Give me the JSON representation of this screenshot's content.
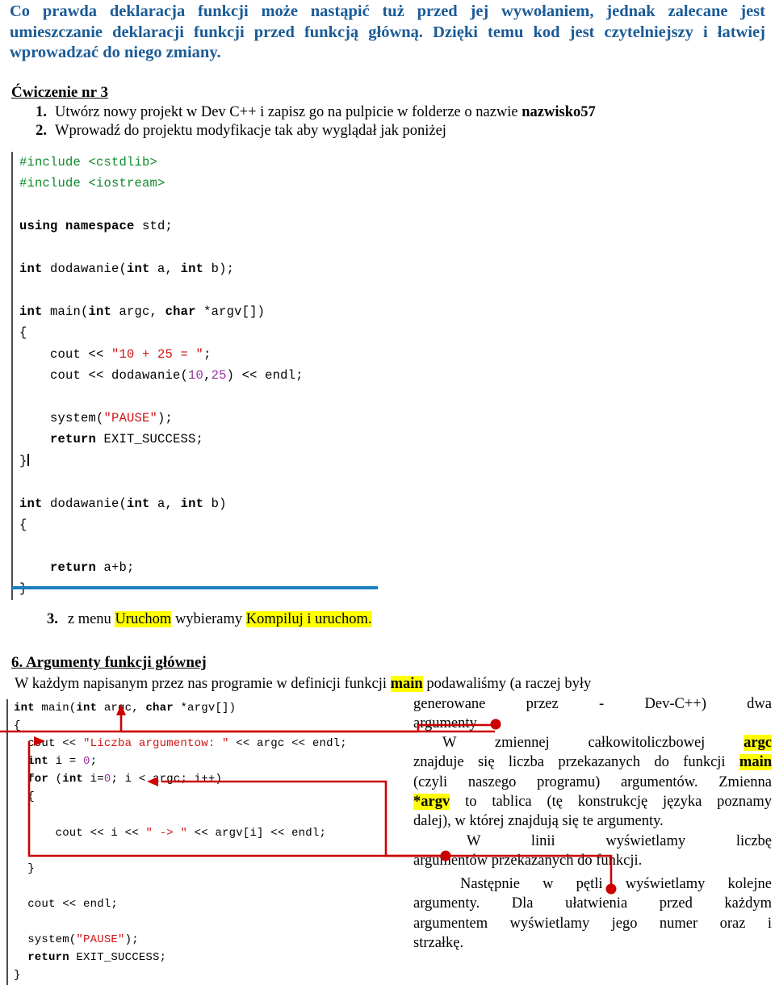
{
  "document": {
    "intro_paragraph": {
      "line1": "Co prawda deklaracja funkcji może nastąpić tuż przed jej wywołaniem, jednak zalecane jest",
      "line2": "umieszczanie deklaracji funkcji przed funkcją główną. Dzięki temu kod jest czytelniejszy i łatwiej",
      "line3": "wprowadzać do niego zmiany."
    },
    "exercise": {
      "heading": "Ćwiczenie nr 3",
      "items": [
        {
          "num": "1.",
          "text_before": "Utwórz nowy projekt w Dev C++ i zapisz go na pulpicie w folderze o nazwie ",
          "bold": "nazwisko57",
          "text_after": ""
        },
        {
          "num": "2.",
          "text_before": "Wprowadź do projektu modyfikacje tak aby wyglądał jak poniżej",
          "bold": "",
          "text_after": ""
        }
      ]
    },
    "step3": {
      "num": "3.",
      "part1": "z menu ",
      "highlight1": "Uruchom",
      "part2": " wybieramy ",
      "highlight2": "Kompiluj i uruchom."
    },
    "section6": {
      "heading": "6. Argumenty funkcji głównej",
      "lead_before": "W każdym napisanym przez nas programie w definicji funkcji ",
      "lead_highlight": "main",
      "lead_after": " podawaliśmy (a raczej były"
    },
    "right_column": {
      "p1_line1": "generowane    przez    -    Dev-C++)    dwa",
      "p1_line2": "argumenty",
      "p2_line1_indent": "W     zmiennej     całkowitoliczbowej ",
      "p2_line1_hl": "argc",
      "p2_line2_a": "znajduje się liczba przekazanych do funkcji ",
      "p2_line2_hl": "main",
      "p2_line3": "(czyli naszego programu) argumentów. Zmienna",
      "p2_line4_hl": "*argv",
      "p2_line4_rest": " to tablica (tę konstrukcję języka poznamy",
      "p2_line5": "dalej), w której znajdują się te argumenty.",
      "p3_line1": "W     linii     wyświetlamy     liczbę",
      "p3_line2": "argumentów przekazanych do funkcji.",
      "p4_line1": "Następnie w pętli wyświetlamy kolejne",
      "p4_line2": "argumenty.   Dla   ułatwienia   przed   każdym",
      "p4_line3": "argumentem  wyświetlamy  jego  numer  oraz  i",
      "p4_line4": "strzałkę."
    },
    "code_block_1": {
      "title": "first-program-listing",
      "lines": [
        [
          {
            "t": "#include <cstdlib>",
            "c": "pp"
          }
        ],
        [
          {
            "t": "#include <iostream>",
            "c": "pp"
          }
        ],
        [
          {
            "t": "",
            "c": "pl"
          }
        ],
        [
          {
            "t": "using namespace ",
            "c": "k"
          },
          {
            "t": "std;",
            "c": "pl"
          }
        ],
        [
          {
            "t": "",
            "c": "pl"
          }
        ],
        [
          {
            "t": "int ",
            "c": "k"
          },
          {
            "t": "dodawanie(",
            "c": "pl"
          },
          {
            "t": "int ",
            "c": "k"
          },
          {
            "t": "a, ",
            "c": "pl"
          },
          {
            "t": "int ",
            "c": "k"
          },
          {
            "t": "b);",
            "c": "pl"
          }
        ],
        [
          {
            "t": "",
            "c": "pl"
          }
        ],
        [
          {
            "t": "int ",
            "c": "k"
          },
          {
            "t": "main(",
            "c": "pl"
          },
          {
            "t": "int ",
            "c": "k"
          },
          {
            "t": "argc, ",
            "c": "pl"
          },
          {
            "t": "char ",
            "c": "k"
          },
          {
            "t": "*argv[])",
            "c": "pl"
          }
        ],
        [
          {
            "t": "{",
            "c": "pl"
          }
        ],
        [
          {
            "t": "    cout << ",
            "c": "pl"
          },
          {
            "t": "\"10 + 25 = \"",
            "c": "st"
          },
          {
            "t": ";",
            "c": "pl"
          }
        ],
        [
          {
            "t": "    cout << dodawanie(",
            "c": "pl"
          },
          {
            "t": "10",
            "c": "nu"
          },
          {
            "t": ",",
            "c": "pl"
          },
          {
            "t": "25",
            "c": "nu"
          },
          {
            "t": ") << endl;",
            "c": "pl"
          }
        ],
        [
          {
            "t": "",
            "c": "pl"
          }
        ],
        [
          {
            "t": "    system(",
            "c": "pl"
          },
          {
            "t": "\"PAUSE\"",
            "c": "st"
          },
          {
            "t": ");",
            "c": "pl"
          }
        ],
        [
          {
            "t": "    return ",
            "c": "k"
          },
          {
            "t": "EXIT_SUCCESS;",
            "c": "pl"
          }
        ],
        [
          {
            "t": "}",
            "c": "pl"
          },
          {
            "t": "|",
            "c": "cur"
          }
        ],
        [
          {
            "t": "",
            "c": "pl"
          }
        ],
        [
          {
            "t": "int ",
            "c": "k"
          },
          {
            "t": "dodawanie(",
            "c": "pl"
          },
          {
            "t": "int ",
            "c": "k"
          },
          {
            "t": "a, ",
            "c": "pl"
          },
          {
            "t": "int ",
            "c": "k"
          },
          {
            "t": "b)",
            "c": "pl"
          }
        ],
        [
          {
            "t": "{",
            "c": "pl"
          }
        ],
        [
          {
            "t": "",
            "c": "pl"
          }
        ],
        [
          {
            "t": "    return ",
            "c": "k"
          },
          {
            "t": "a+b;",
            "c": "pl"
          }
        ],
        [
          {
            "t": "}",
            "c": "pl"
          }
        ]
      ]
    },
    "code_block_2": {
      "title": "argv-program-listing",
      "lines": [
        [
          {
            "t": "int ",
            "c": "k"
          },
          {
            "t": "main(",
            "c": "pl"
          },
          {
            "t": "int ",
            "c": "k"
          },
          {
            "t": "argc, ",
            "c": "pl"
          },
          {
            "t": "char ",
            "c": "k"
          },
          {
            "t": "*argv[])",
            "c": "pl"
          }
        ],
        [
          {
            "t": "{",
            "c": "pl"
          }
        ],
        [
          {
            "t": "  cout << ",
            "c": "pl"
          },
          {
            "t": "\"Liczba argumentow: \"",
            "c": "st"
          },
          {
            "t": " << argc << endl;",
            "c": "pl"
          }
        ],
        [
          {
            "t": "  int ",
            "c": "k"
          },
          {
            "t": "i = ",
            "c": "pl"
          },
          {
            "t": "0",
            "c": "nu"
          },
          {
            "t": ";",
            "c": "pl"
          }
        ],
        [
          {
            "t": "  for ",
            "c": "k"
          },
          {
            "t": "(",
            "c": "pl"
          },
          {
            "t": "int ",
            "c": "k"
          },
          {
            "t": "i=",
            "c": "pl"
          },
          {
            "t": "0",
            "c": "nu"
          },
          {
            "t": "; i < argc; i++)",
            "c": "pl"
          }
        ],
        [
          {
            "t": "  {",
            "c": "pl"
          }
        ],
        [
          {
            "t": "",
            "c": "pl"
          }
        ],
        [
          {
            "t": "      cout << i << ",
            "c": "pl"
          },
          {
            "t": "\" -> \"",
            "c": "st"
          },
          {
            "t": " << argv[i] << endl;",
            "c": "pl"
          }
        ],
        [
          {
            "t": "",
            "c": "pl"
          }
        ],
        [
          {
            "t": "  }",
            "c": "pl"
          }
        ],
        [
          {
            "t": "",
            "c": "pl"
          }
        ],
        [
          {
            "t": "  cout << endl;",
            "c": "pl"
          }
        ],
        [
          {
            "t": "",
            "c": "pl"
          }
        ],
        [
          {
            "t": "  system(",
            "c": "pl"
          },
          {
            "t": "\"PAUSE\"",
            "c": "st"
          },
          {
            "t": ");",
            "c": "pl"
          }
        ],
        [
          {
            "t": "  return ",
            "c": "k"
          },
          {
            "t": "EXIT_SUCCESS;",
            "c": "pl"
          }
        ],
        [
          {
            "t": "}",
            "c": "pl"
          }
        ]
      ]
    },
    "colors": {
      "intro_blue": "#1b5b96",
      "rule_blue": "#1b7fc4",
      "highlight_yellow": "#ffff00",
      "connector_red": "#cc0000",
      "code_string": "#d01414",
      "code_preprocessor": "#128a2c",
      "code_number": "#9b2fa0",
      "code_gutter": "#4a4a4a"
    }
  }
}
